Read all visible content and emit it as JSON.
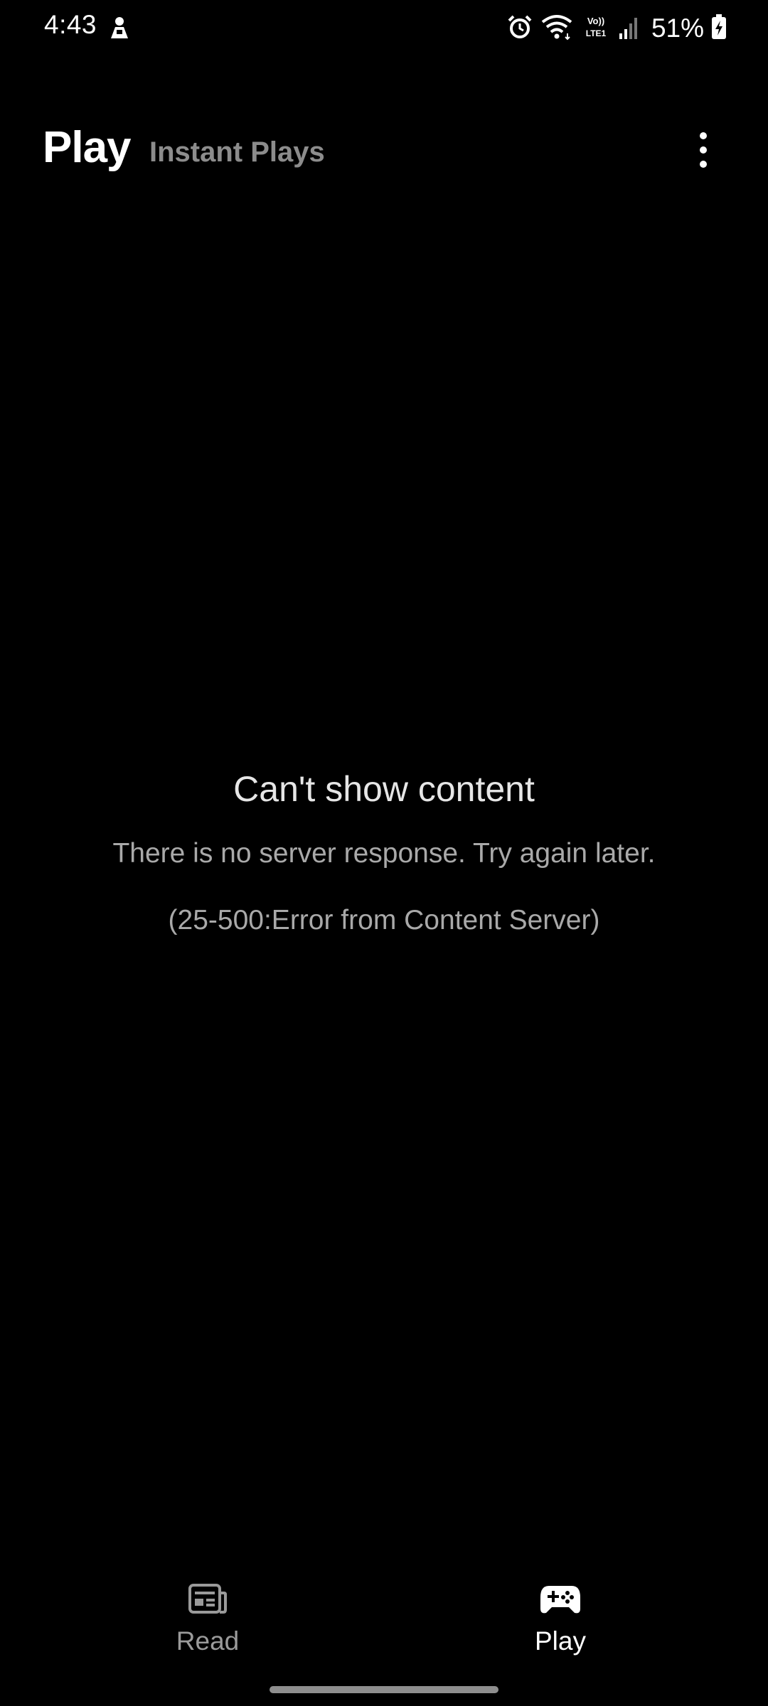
{
  "status_bar": {
    "time": "4:43",
    "battery": "51%",
    "icons": [
      "bixby-notification-icon",
      "alarm-icon",
      "wifi-icon",
      "volte-lte-icon",
      "cell-signal-icon",
      "battery-charging-icon"
    ]
  },
  "header": {
    "title": "Play",
    "tab": "Instant Plays",
    "more_icon": "more-vertical-icon"
  },
  "error": {
    "title": "Can't show content",
    "message": "There is no server response. Try again later.",
    "code": "(25-500:Error from Content Server)"
  },
  "bottom_nav": {
    "items": [
      {
        "label": "Read",
        "icon": "newspaper-icon",
        "selected": false
      },
      {
        "label": "Play",
        "icon": "gamepad-icon",
        "selected": true
      }
    ]
  },
  "colors": {
    "background": "#000000",
    "primary_text": "#ffffff",
    "secondary_text": "#a9a9a9",
    "inactive_tab": "#8c8c8c"
  }
}
